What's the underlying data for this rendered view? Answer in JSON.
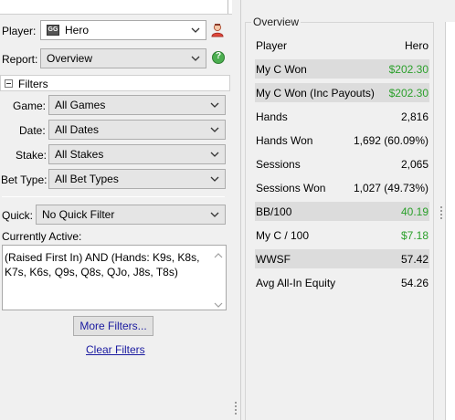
{
  "left": {
    "player": {
      "label": "Player:",
      "value": "Hero",
      "site_icon_text": "GG"
    },
    "report": {
      "label": "Report:",
      "value": "Overview"
    },
    "filters_header": "Filters",
    "game": {
      "label": "Game:",
      "value": "All Games"
    },
    "date": {
      "label": "Date:",
      "value": "All Dates"
    },
    "stake": {
      "label": "Stake:",
      "value": "All Stakes"
    },
    "bet_type": {
      "label": "Bet Type:",
      "value": "All Bet Types"
    },
    "quick": {
      "label": "Quick:",
      "value": "No Quick Filter"
    },
    "currently_active": {
      "label": "Currently Active:",
      "text": "(Raised First In) AND (Hands: K9s, K8s, K7s, K6s, Q9s, Q8s, QJo, J8s, T8s)"
    },
    "more_filters_button": "More Filters...",
    "clear_filters_link": "Clear Filters"
  },
  "overview": {
    "title": "Overview",
    "header": {
      "label": "Player",
      "value": "Hero"
    },
    "rows": [
      {
        "label": "My C Won",
        "value": "$202.30",
        "color": "green",
        "shaded": true
      },
      {
        "label": "My C Won (Inc Payouts)",
        "value": "$202.30",
        "color": "green",
        "shaded": true
      },
      {
        "label": "Hands",
        "value": "2,816",
        "color": "default",
        "shaded": false
      },
      {
        "label": "Hands Won",
        "value": "1,692 (60.09%)",
        "color": "default",
        "shaded": false
      },
      {
        "label": "Sessions",
        "value": "2,065",
        "color": "default",
        "shaded": false
      },
      {
        "label": "Sessions Won",
        "value": "1,027 (49.73%)",
        "color": "default",
        "shaded": false
      },
      {
        "label": "BB/100",
        "value": "40.19",
        "color": "green",
        "shaded": true
      },
      {
        "label": "My C / 100",
        "value": "$7.18",
        "color": "green",
        "shaded": false
      },
      {
        "label": "WWSF",
        "value": "57.42",
        "color": "default",
        "shaded": true
      },
      {
        "label": "Avg All-In Equity",
        "value": "54.26",
        "color": "default",
        "shaded": false
      }
    ]
  },
  "colors": {
    "positive": "#2ba02b",
    "link": "#1a1aa0",
    "row_shade": "#dcdcdc"
  }
}
